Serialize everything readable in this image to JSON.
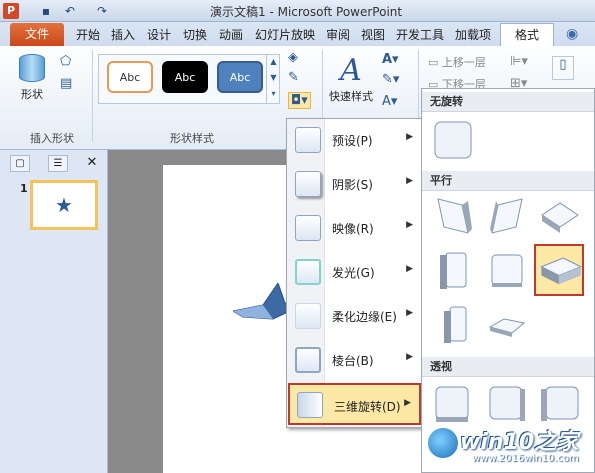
{
  "window": {
    "title": "演示文稿1 - Microsoft PowerPoint",
    "app_badge": "P"
  },
  "tabs": [
    "开始",
    "插入",
    "设计",
    "切换",
    "动画",
    "幻灯片放映",
    "审阅",
    "视图",
    "开发工具",
    "加载项"
  ],
  "tab_file": "文件",
  "tab_format": "格式",
  "ribbon": {
    "shape_label": "形状",
    "group_insert_shapes": "插入形状",
    "group_shape_styles": "形状样式",
    "style_thumbs": [
      "Abc",
      "Abc",
      "Abc"
    ],
    "quick_style_label": "快速样式",
    "arrange": [
      "上移一层",
      "下移一层"
    ]
  },
  "slide_panel": {
    "slide_number": "1"
  },
  "menu": {
    "items": [
      {
        "label": "预设(P)"
      },
      {
        "label": "阴影(S)"
      },
      {
        "label": "映像(R)"
      },
      {
        "label": "发光(G)"
      },
      {
        "label": "柔化边缘(E)"
      },
      {
        "label": "棱台(B)"
      },
      {
        "label": "三维旋转(D)",
        "active": true
      }
    ]
  },
  "submenu": {
    "sections": [
      {
        "title": "无旋转"
      },
      {
        "title": "平行"
      },
      {
        "title": "透视"
      }
    ]
  },
  "watermark": {
    "text": "win10之家",
    "url": "www.2016win10.com"
  },
  "colors": {
    "file_tab": "#d24726",
    "highlight": "#fde8a6",
    "highlight_border": "#c0392b"
  }
}
